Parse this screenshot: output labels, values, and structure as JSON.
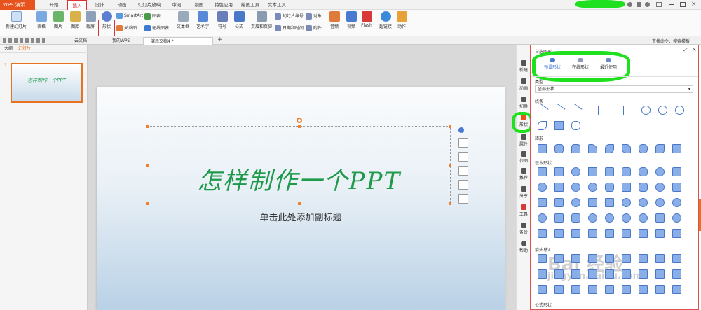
{
  "app": {
    "logo": "WPS 演示"
  },
  "menu_tabs": [
    "开始",
    "插入",
    "设计",
    "动画",
    "幻灯片放映",
    "审阅",
    "视图",
    "特色应用",
    "绘图工具",
    "文本工具"
  ],
  "ribbon": {
    "new_slide": "新建幻灯片",
    "table": "表格",
    "picture": "图片",
    "gallery": "图库",
    "screenshot": "截屏",
    "shape": "形状",
    "smartart": "SmartArt",
    "relation": "关系图",
    "chart": "图表",
    "online_chart": "在线图表",
    "textbox": "文本框",
    "wordart": "艺术字",
    "symbol": "符号",
    "formula": "公式",
    "header_footer": "页眉和页脚",
    "slide_number": "幻灯片编号",
    "datetime": "日期和时间",
    "object": "对象",
    "attachment": "附件",
    "audio": "音频",
    "video": "视频",
    "flash": "Flash",
    "hyperlink": "超链接",
    "action": "动作"
  },
  "search_hint": "查找命令、搜索模板",
  "doc_tabs": [
    "云文档",
    "我的WPS",
    "演示文稿4 *"
  ],
  "left_pane": {
    "tab_outline": "大纲",
    "tab_slides": "幻灯片",
    "slide_number": "1",
    "thumb_text": "怎样制作一个PPT"
  },
  "slide": {
    "title": "怎样制作一个PPT",
    "subtitle": "单击此处添加副标题"
  },
  "icon_column": [
    {
      "label": "新建",
      "icon": "new-icon"
    },
    {
      "label": "动画",
      "icon": "animation-icon"
    },
    {
      "label": "切换",
      "icon": "transition-icon"
    },
    {
      "label": "形状",
      "icon": "shape-icon"
    },
    {
      "label": "属性",
      "icon": "property-icon"
    },
    {
      "label": "作图",
      "icon": "draw-icon"
    },
    {
      "label": "推荐",
      "icon": "recommend-icon"
    },
    {
      "label": "分享",
      "icon": "share-icon"
    },
    {
      "label": "工具",
      "icon": "tool-icon"
    },
    {
      "label": "备份",
      "icon": "backup-icon"
    },
    {
      "label": "帮助",
      "icon": "help-icon"
    }
  ],
  "panel": {
    "title": "自选图形",
    "tabs": [
      "预设形状",
      "在线形状",
      "最近使用"
    ],
    "type_label": "类型",
    "type_select": "全部形状",
    "sections": [
      "线条",
      "矩形",
      "基本形状",
      "箭头总汇",
      "公式形状"
    ],
    "basic_numbers": [
      "8",
      "10",
      "12"
    ]
  },
  "watermark": {
    "line1": "Bai 经验",
    "line2": "jingyan.baidu.com"
  }
}
